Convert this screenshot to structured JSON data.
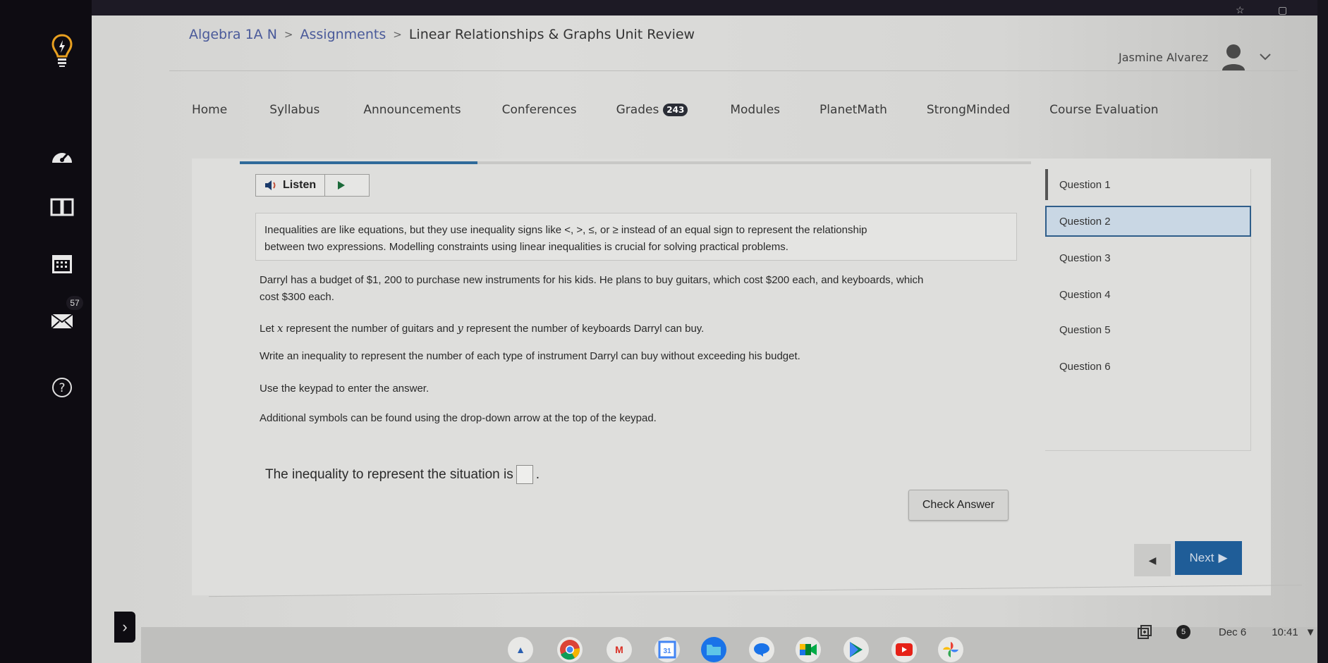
{
  "breadcrumb": {
    "course": "Algebra 1A N",
    "section": "Assignments",
    "page": "Linear Relationships & Graphs Unit Review",
    "separator": ">"
  },
  "user": {
    "name": "Jasmine Alvarez"
  },
  "left_rail": {
    "items": [
      {
        "icon": "lightbulb-logo-icon"
      },
      {
        "icon": "dashboard-icon"
      },
      {
        "icon": "courses-book-icon"
      },
      {
        "icon": "calendar-icon"
      },
      {
        "icon": "inbox-icon",
        "badge": "57"
      },
      {
        "icon": "help-icon"
      }
    ]
  },
  "course_nav": {
    "items": [
      {
        "label": "Home"
      },
      {
        "label": "Syllabus"
      },
      {
        "label": "Announcements"
      },
      {
        "label": "Conferences"
      },
      {
        "label": "Grades",
        "badge": "243"
      },
      {
        "label": "Modules"
      },
      {
        "label": "PlanetMath"
      },
      {
        "label": "StrongMinded"
      },
      {
        "label": "Course Evaluation"
      }
    ]
  },
  "assignment_progress": {
    "fraction": 0.3
  },
  "listen": {
    "label": "Listen"
  },
  "question": {
    "intro_line1": "Inequalities are like equations, but they use inequality signs like <, >, ≤, or ≥ instead of an equal sign to represent the relationship",
    "intro_line2": "between two expressions. Modelling constraints using linear inequalities is crucial for solving practical problems.",
    "problem_line1": "Darryl has a budget of $1, 200 to purchase new instruments for his kids. He plans to buy guitars, which cost $200 each, and keyboards, which",
    "problem_line2": "cost $300 each.",
    "variables_pre": "Let ",
    "var_x": "x",
    "variables_mid": " represent the number of guitars and ",
    "var_y": "y",
    "variables_post": " represent the number of keyboards Darryl can buy.",
    "task": "Write an inequality to represent the number of each type of instrument Darryl can buy without exceeding his budget.",
    "keypad_hint": "Use the keypad to enter the answer.",
    "symbols_hint": "Additional symbols can be found using the drop-down arrow at the top of the keypad.",
    "answer_prompt": "The inequality to represent the situation is",
    "answer_value": "",
    "answer_suffix": "."
  },
  "check_answer": {
    "label": "Check Answer"
  },
  "question_list": {
    "items": [
      {
        "label": "Question 1"
      },
      {
        "label": "Question 2",
        "active": true
      },
      {
        "label": "Question 3"
      },
      {
        "label": "Question 4"
      },
      {
        "label": "Question 5"
      },
      {
        "label": "Question 6"
      }
    ]
  },
  "pager": {
    "prev_label": "◀",
    "next_label": "Next",
    "next_arrow": "▶"
  },
  "shelf": {
    "apps": [
      "launcher",
      "chrome",
      "gmail",
      "calendar",
      "files",
      "messages",
      "meet",
      "play-store",
      "youtube",
      "photos"
    ],
    "calendar_day": "31"
  },
  "tray": {
    "notification_count": "5",
    "date": "Dec 6",
    "time": "10:41"
  },
  "accent_colors": {
    "primary": "#1f5d98",
    "active_question_bg": "#c9d7e4"
  }
}
